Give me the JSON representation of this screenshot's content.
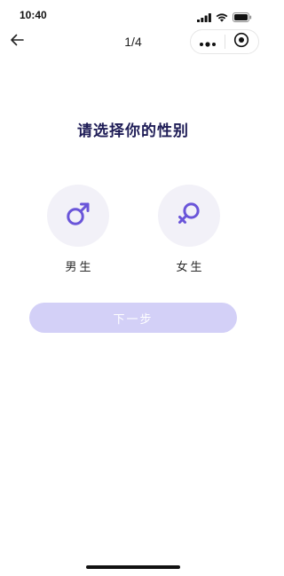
{
  "status_bar": {
    "time": "10:40"
  },
  "nav": {
    "title": "1/4",
    "icons": [
      "back-arrow-icon",
      "more-dots-icon",
      "close-circle-icon"
    ]
  },
  "main": {
    "heading": "请选择你的性别",
    "options": [
      {
        "label": "男生",
        "icon": "male-symbol-icon"
      },
      {
        "label": "女生",
        "icon": "female-symbol-icon"
      }
    ],
    "next_label": "下一步"
  },
  "colors": {
    "accent": "#6a55d9",
    "heading": "#1f1d57",
    "option_bg": "#f2f1f8",
    "button_disabled": "#d3d0f7"
  }
}
